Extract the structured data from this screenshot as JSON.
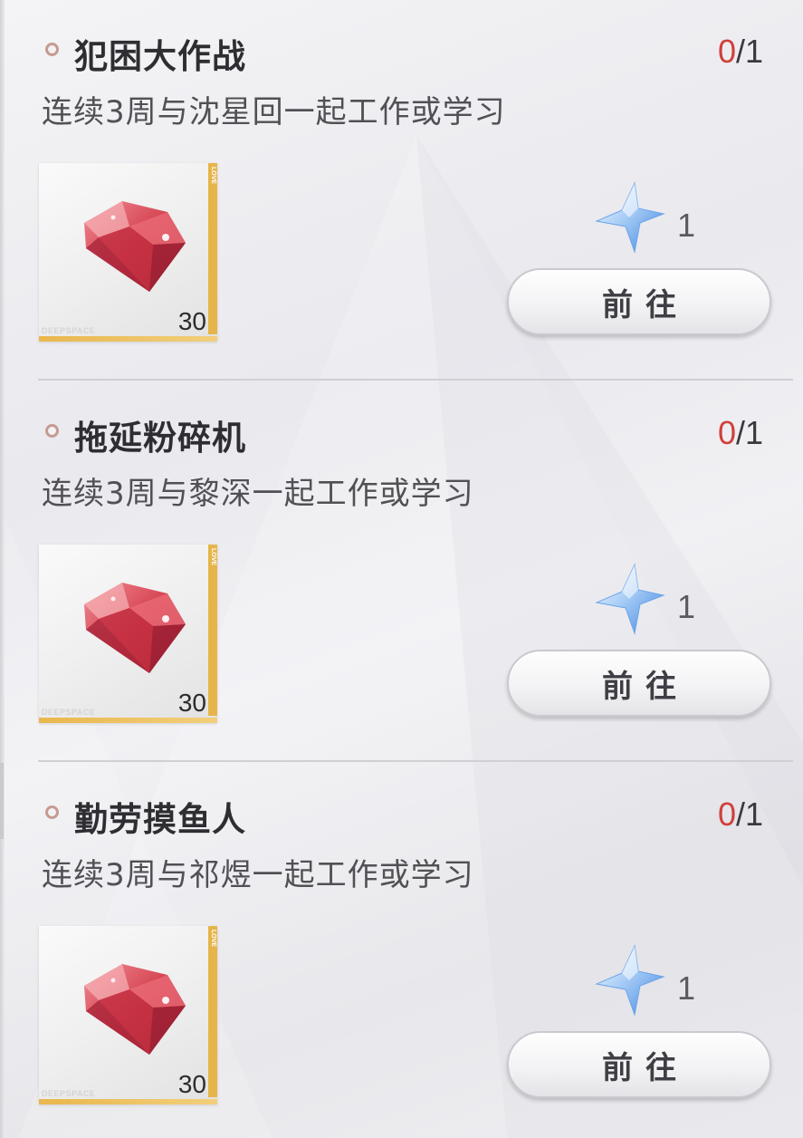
{
  "quests": [
    {
      "title": "犯困大作战",
      "progress_current": "0",
      "progress_total": "/1",
      "description": "连续3周与沈星回一起工作或学习",
      "reward_item": "red-gem-icon",
      "reward_count": "30",
      "reward_watermark": "DEEPSPACE",
      "reward_tag": "LOVE",
      "star_icon": "star-icon",
      "star_count": "1",
      "button_label": "前往"
    },
    {
      "title": "拖延粉碎机",
      "progress_current": "0",
      "progress_total": "/1",
      "description": "连续3周与黎深一起工作或学习",
      "reward_item": "red-gem-icon",
      "reward_count": "30",
      "reward_watermark": "DEEPSPACE",
      "reward_tag": "LOVE",
      "star_icon": "star-icon",
      "star_count": "1",
      "button_label": "前往"
    },
    {
      "title": "勤劳摸鱼人",
      "progress_current": "0",
      "progress_total": "/1",
      "description": "连续3周与祁煜一起工作或学习",
      "reward_item": "red-gem-icon",
      "reward_count": "30",
      "reward_watermark": "DEEPSPACE",
      "reward_tag": "LOVE",
      "star_icon": "star-icon",
      "star_count": "1",
      "button_label": "前往"
    }
  ],
  "colors": {
    "progress_current": "#d0413b",
    "bullet": "#c79a92",
    "gem": "#d9424f",
    "star": "#7fb2f0",
    "reward_frame": "#e6b54a"
  }
}
